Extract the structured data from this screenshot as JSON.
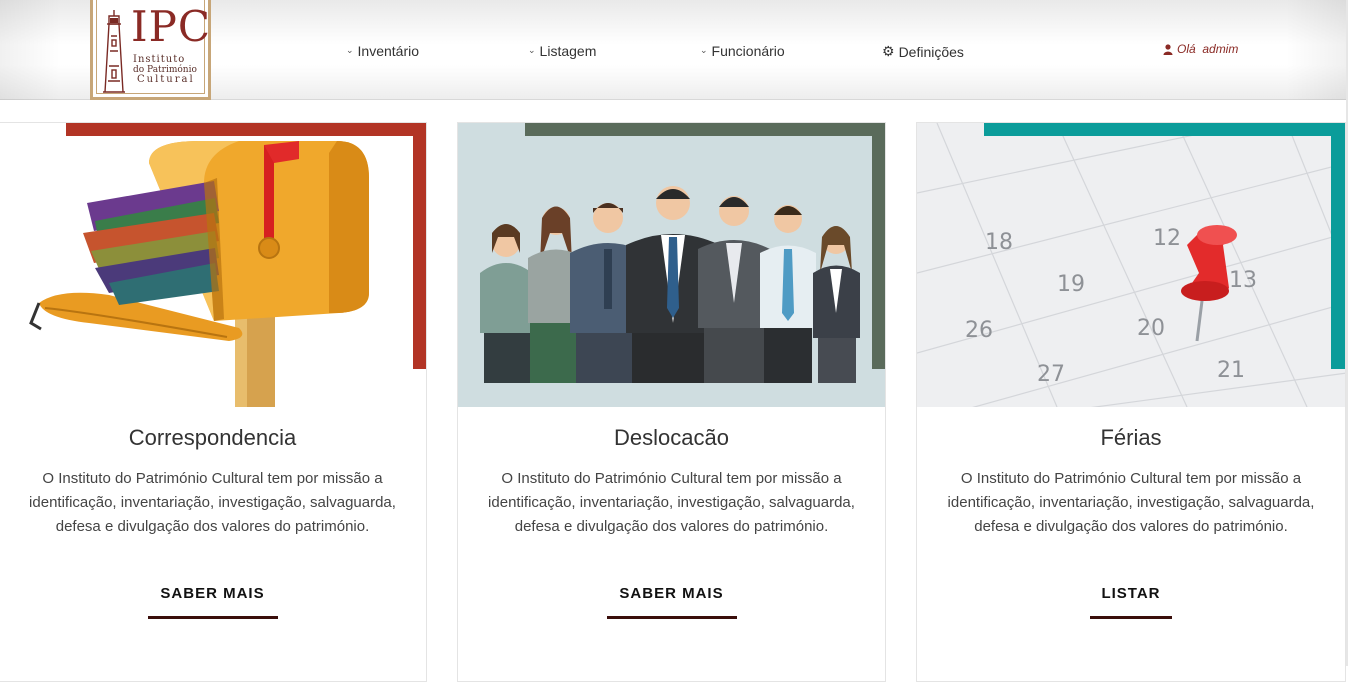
{
  "logo": {
    "abbr": "IPC",
    "line1": "Instituto",
    "line2": "do Património",
    "line3": "Cultural"
  },
  "nav": {
    "items": [
      {
        "label": "Inventário",
        "icon": "chevron-down-icon"
      },
      {
        "label": "Listagem",
        "icon": "chevron-down-icon"
      },
      {
        "label": "Funcionário",
        "icon": "chevron-down-icon"
      },
      {
        "label": "Definições",
        "icon": "gear-icon"
      }
    ],
    "greeting": "Olá  admim"
  },
  "colors": {
    "brand": "#8a2a25",
    "card1_accent": "#b23425",
    "card2_accent": "#5a6b5b",
    "card3_accent": "#0b9c9a",
    "button_underline": "#3a0e0b"
  },
  "cards": [
    {
      "title": "Correspondencia",
      "text": "O Instituto do Património Cultural tem por missão a identificação, inventariação, investigação, salvaguarda, defesa e divulgação dos valores do património.",
      "button": "SABER MAIS",
      "image": "mailbox-image"
    },
    {
      "title": "Deslocacão",
      "text": "O Instituto do Património Cultural tem por missão a identificação, inventariação, investigação, salvaguarda, defesa e divulgação dos valores do património.",
      "button": "SABER MAIS",
      "image": "business-people-image"
    },
    {
      "title": "Férias",
      "text": "O Instituto do Património Cultural tem por missão a identificação, inventariação, investigação, salvaguarda, defesa e divulgação dos valores do património.",
      "button": "LISTAR",
      "image": "calendar-pin-image",
      "calendar_numbers": [
        "18",
        "12",
        "19",
        "13",
        "26",
        "20",
        "27",
        "21"
      ]
    }
  ]
}
